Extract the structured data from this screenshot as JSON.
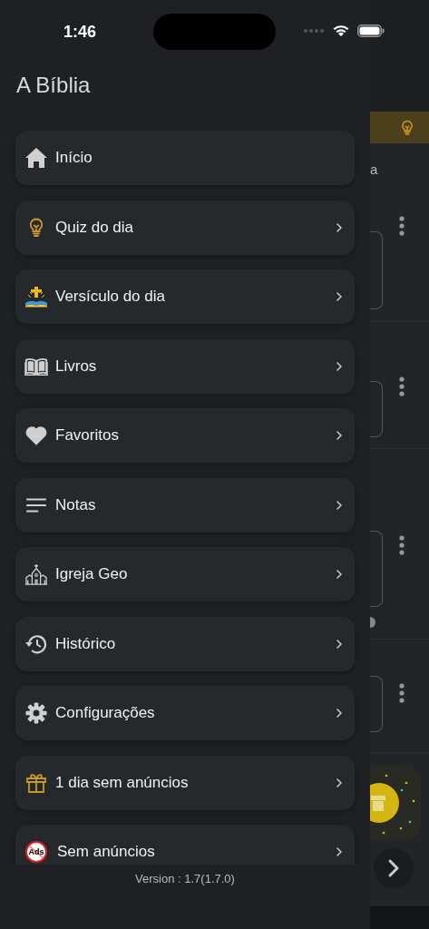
{
  "status_bar": {
    "time": "1:46"
  },
  "drawer": {
    "title": "A Bíblia",
    "items": [
      {
        "label": "Início",
        "kind": "home",
        "chevron": false
      },
      {
        "label": "Quiz do dia",
        "kind": "quiz",
        "chevron": true
      },
      {
        "label": "Versículo do dia",
        "kind": "verse",
        "chevron": true
      },
      {
        "label": "Livros",
        "kind": "books",
        "chevron": true
      },
      {
        "label": "Favoritos",
        "kind": "favorites",
        "chevron": true
      },
      {
        "label": "Notas",
        "kind": "notes",
        "chevron": true
      },
      {
        "label": "Igreja Geo",
        "kind": "church",
        "chevron": true
      },
      {
        "label": "Histórico",
        "kind": "history",
        "chevron": true
      },
      {
        "label": "Configurações",
        "kind": "settings",
        "chevron": true
      },
      {
        "label": "1 dia sem anúncios",
        "kind": "gift",
        "chevron": true
      },
      {
        "label": "Sem anúncios",
        "kind": "noads",
        "icon_text": "Ads",
        "chevron": true
      }
    ],
    "version": "Version : 1.7(1.7.0)"
  },
  "background_screen": {
    "text_fragment": "a"
  }
}
